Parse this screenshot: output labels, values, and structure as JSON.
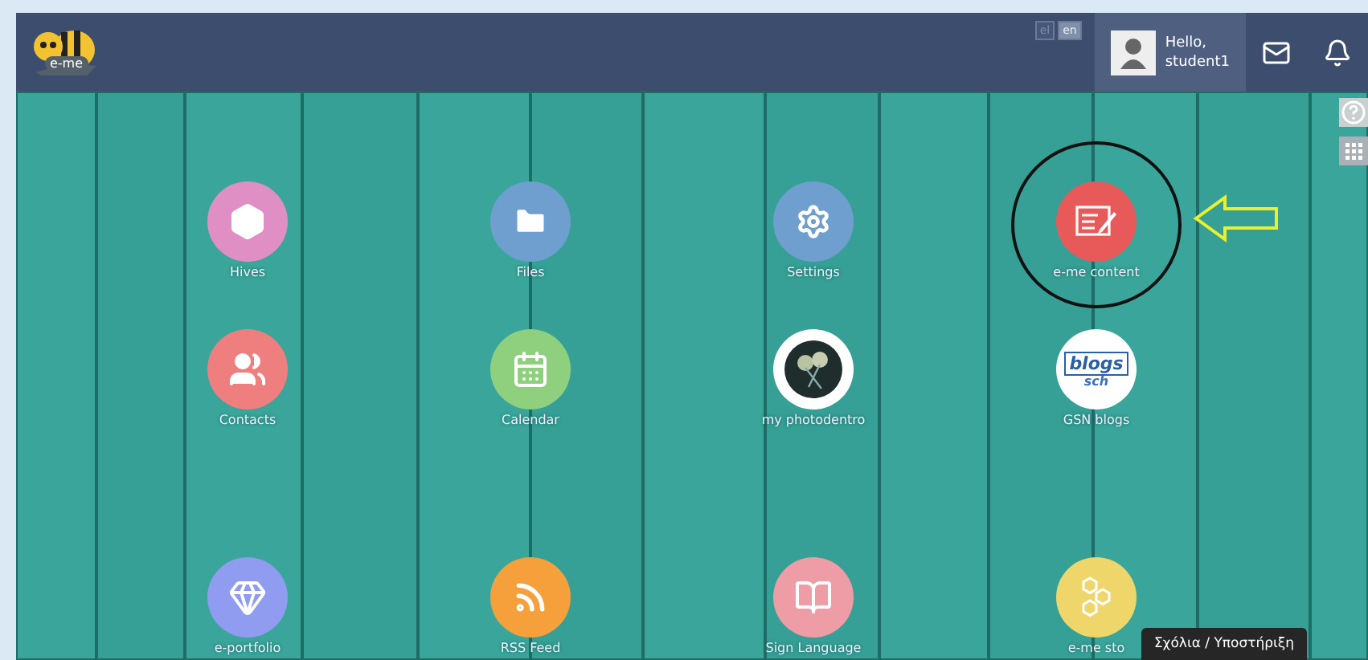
{
  "header": {
    "logo_text": "e-me",
    "languages": [
      {
        "label": "el",
        "selected": false
      },
      {
        "label": "en",
        "selected": true
      }
    ],
    "user": {
      "greeting": "Hello,",
      "name": "student1"
    }
  },
  "apps": [
    {
      "kind": "hives",
      "label": "Hives",
      "color": "#e08fc4",
      "highlighted": false
    },
    {
      "kind": "files",
      "label": "Files",
      "color": "#6f9fcf",
      "highlighted": false
    },
    {
      "kind": "settings",
      "label": "Settings",
      "color": "#6f9fcf",
      "highlighted": false
    },
    {
      "kind": "content",
      "label": "e-me content",
      "color": "#e85a5a",
      "highlighted": true
    },
    {
      "kind": "contacts",
      "label": "Contacts",
      "color": "#ef7f7f",
      "highlighted": false
    },
    {
      "kind": "calendar",
      "label": "Calendar",
      "color": "#8fd07f",
      "highlighted": false
    },
    {
      "kind": "photodentro",
      "label": "my photodentro",
      "color": "#ffffff",
      "highlighted": false
    },
    {
      "kind": "blogs",
      "label": "GSN blogs",
      "color": "#ffffff",
      "highlighted": false,
      "logo_text": [
        "blogs",
        "sch"
      ]
    },
    {
      "kind": "portfolio",
      "label": "e-portfolio",
      "color": "#8f9cf0",
      "highlighted": false
    },
    {
      "kind": "rss",
      "label": "RSS Feed",
      "color": "#f6a03c",
      "highlighted": false
    },
    {
      "kind": "sign",
      "label": "Sign Language",
      "color": "#ee9ca6",
      "highlighted": false
    },
    {
      "kind": "store",
      "label": "e-me sto",
      "color": "#efd66a",
      "highlighted": false
    }
  ],
  "tooltip": "Σχόλια / Υποστήριξη"
}
